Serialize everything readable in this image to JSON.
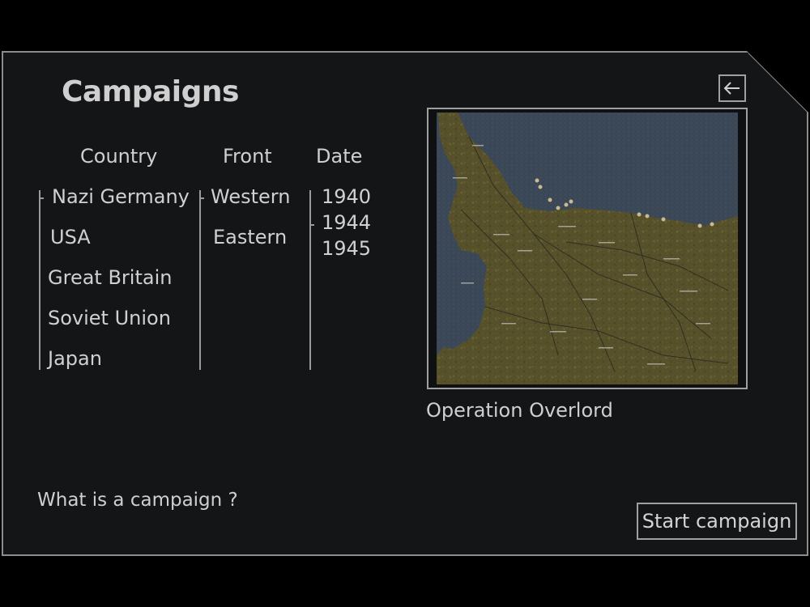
{
  "screen": {
    "title": "Campaigns",
    "back_icon": "arrow-left-icon"
  },
  "columns": {
    "country": {
      "header": "Country",
      "options": [
        "Nazi Germany",
        "USA",
        "Great Britain",
        "Soviet Union",
        "Japan"
      ],
      "selected": "Nazi Germany"
    },
    "front": {
      "header": "Front",
      "options": [
        "Western",
        "Eastern"
      ],
      "selected": "Western"
    },
    "date": {
      "header": "Date",
      "options": [
        "1940",
        "1944",
        "1945"
      ],
      "selected": "1944"
    }
  },
  "preview": {
    "caption": "Operation Overlord",
    "colors": {
      "sea": "#3d4a5a",
      "land": "#59532c",
      "roads": "#2b2a22",
      "beach": "#c9b98d"
    }
  },
  "footer": {
    "help_link": "What is a campaign ?",
    "start_button": "Start campaign"
  },
  "colors": {
    "background": "#141517",
    "border": "#8c8c8c",
    "text": "#cfcfcf"
  }
}
